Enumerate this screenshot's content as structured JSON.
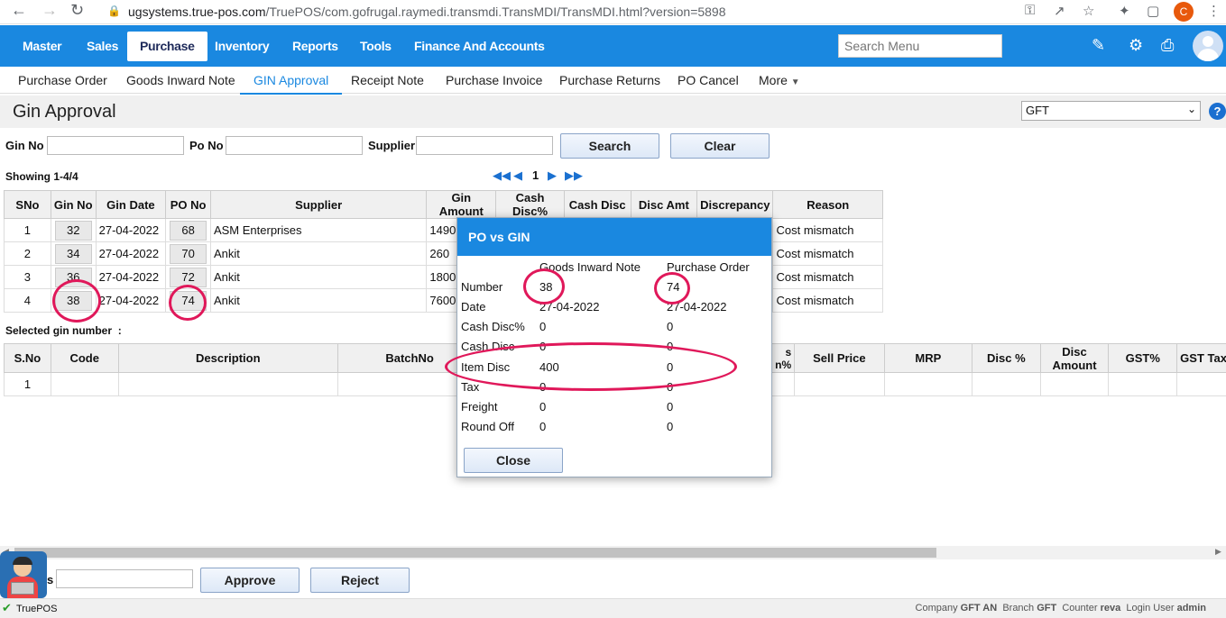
{
  "browser": {
    "url_host": "ugsystems.true-pos.com",
    "url_path": "/TruePOS/com.gofrugal.raymedi.transmdi.TransMDI/TransMDI.html?version=5898",
    "profile_letter": "C"
  },
  "topnav": {
    "items": [
      "Master",
      "Sales",
      "Purchase",
      "Inventory",
      "Reports",
      "Tools",
      "Finance And Accounts"
    ],
    "search_placeholder": "Search Menu"
  },
  "subnav": {
    "items": [
      "Purchase Order",
      "Goods Inward Note",
      "GIN Approval",
      "Receipt Note",
      "Purchase Invoice",
      "Purchase Returns",
      "PO Cancel"
    ],
    "more": "More"
  },
  "page": {
    "title": "Gin Approval",
    "branch_select": "GFT",
    "help": "?"
  },
  "filters": {
    "gin_no_label": "Gin No",
    "po_no_label": "Po No",
    "supplier_label": "Supplier",
    "search": "Search",
    "clear": "Clear"
  },
  "pager": {
    "showing": "Showing 1-4/4",
    "page": "1"
  },
  "gin_table": {
    "headers": [
      "SNo",
      "Gin No",
      "Gin Date",
      "PO No",
      "Supplier",
      "Gin Amount",
      "Cash Disc%",
      "Cash Disc",
      "Disc Amt",
      "Discrepancy",
      "Reason"
    ],
    "rows": [
      {
        "sno": "1",
        "gin": "32",
        "date": "27-04-2022",
        "po": "68",
        "supplier": "ASM Enterprises",
        "amount": "1490",
        "reason": "Cost mismatch"
      },
      {
        "sno": "2",
        "gin": "34",
        "date": "27-04-2022",
        "po": "70",
        "supplier": "Ankit",
        "amount": "260",
        "reason": "Cost mismatch"
      },
      {
        "sno": "3",
        "gin": "36",
        "date": "27-04-2022",
        "po": "72",
        "supplier": "Ankit",
        "amount": "1800",
        "reason": "Cost mismatch"
      },
      {
        "sno": "4",
        "gin": "38",
        "date": "27-04-2022",
        "po": "74",
        "supplier": "Ankit",
        "amount": "7600",
        "reason": "Cost mismatch"
      }
    ]
  },
  "selected_label": "Selected gin number  :",
  "item_table": {
    "headers": [
      "S.No",
      "Code",
      "Description",
      "BatchNo",
      "s\nn%",
      "Sell Price",
      "MRP",
      "Disc %",
      "Disc\nAmount",
      "GST%",
      "GST Tax"
    ],
    "row_sno": "1"
  },
  "modal": {
    "title": "PO vs GIN",
    "col1": "Goods Inward Note",
    "col2": "Purchase Order",
    "rows": [
      {
        "label": "Number",
        "gin": "38",
        "po": "74"
      },
      {
        "label": "Date",
        "gin": "27-04-2022",
        "po": "27-04-2022"
      },
      {
        "label": "Cash Disc%",
        "gin": "0",
        "po": "0"
      },
      {
        "label": "Cash Disc",
        "gin": "0",
        "po": "0"
      },
      {
        "label": "Item Disc",
        "gin": "400",
        "po": "0"
      },
      {
        "label": "Tax",
        "gin": "0",
        "po": "0"
      },
      {
        "label": "Freight",
        "gin": "0",
        "po": "0"
      },
      {
        "label": "Round Off",
        "gin": "0",
        "po": "0"
      }
    ],
    "close": "Close"
  },
  "footer": {
    "remarks_label": "s",
    "approve": "Approve",
    "reject": "Reject"
  },
  "status": {
    "app": "TruePOS",
    "company_label": "Company",
    "company": "GFT AN",
    "branch_label": "Branch",
    "branch": "GFT",
    "counter_label": "Counter",
    "counter": "reva",
    "login_label": "Login User",
    "login": "admin"
  },
  "colors": {
    "accent": "#1a88e0",
    "highlight": "#e0185a"
  }
}
